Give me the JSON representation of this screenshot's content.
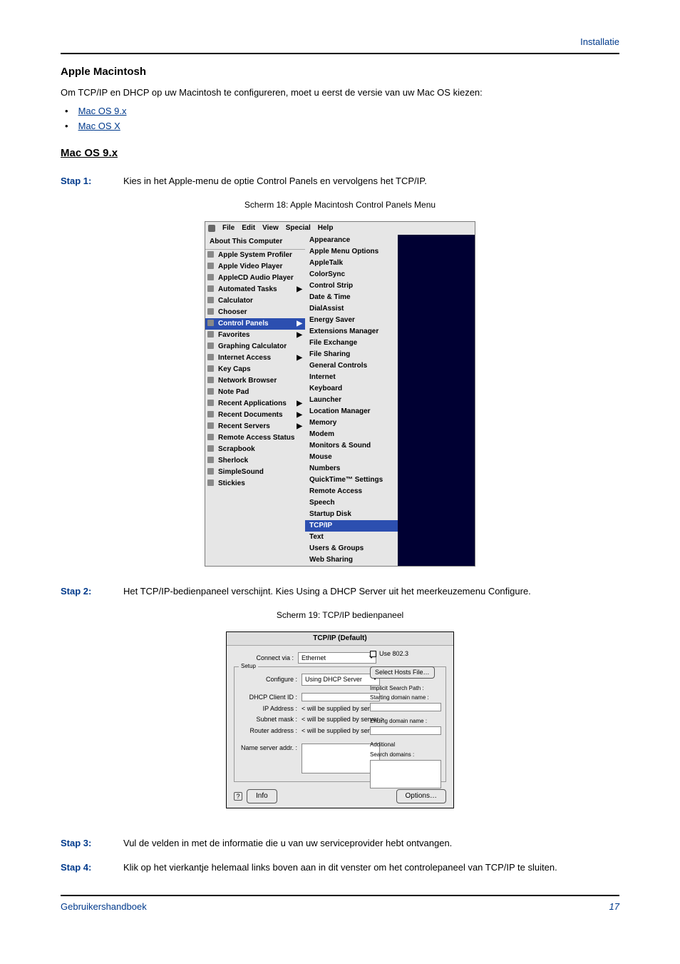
{
  "header": {
    "section": "Installatie"
  },
  "titles": {
    "apple_mac": "Apple Macintosh",
    "mac9": "Mac OS 9.x"
  },
  "intro": "Om TCP/IP en DHCP op uw Macintosh te configureren, moet u eerst de versie van uw Mac OS kiezen:",
  "links": {
    "mac9": "Mac OS 9.x",
    "macx": "Mac OS X"
  },
  "steps": {
    "s1_label": "Stap 1:",
    "s1_text": "Kies in het Apple-menu de optie Control Panels en vervolgens het TCP/IP.",
    "s2_label": "Stap 2:",
    "s2_text": "Het TCP/IP-bedienpaneel verschijnt. Kies Using a DHCP Server uit het meerkeuzemenu Configure.",
    "s3_label": "Stap 3:",
    "s3_text": "Vul de velden in met de informatie die u van uw serviceprovider hebt ontvangen.",
    "s4_label": "Stap 4:",
    "s4_text": "Klik op het vierkantje helemaal links boven aan in dit venster om het controlepaneel van TCP/IP te sluiten."
  },
  "captions": {
    "c18": "Scherm 18: Apple Macintosh Control Panels Menu",
    "c19": "Scherm 19: TCP/IP bedienpaneel"
  },
  "apple_menu": {
    "menubar": [
      "File",
      "Edit",
      "View",
      "Special",
      "Help"
    ],
    "top": "About This Computer",
    "items": [
      "Apple System Profiler",
      "Apple Video Player",
      "AppleCD Audio Player",
      "Automated Tasks",
      "Calculator",
      "Chooser",
      "Control Panels",
      "Favorites",
      "Graphing Calculator",
      "Internet Access",
      "Key Caps",
      "Network Browser",
      "Note Pad",
      "Recent Applications",
      "Recent Documents",
      "Recent Servers",
      "Remote Access Status",
      "Scrapbook",
      "Sherlock",
      "SimpleSound",
      "Stickies"
    ],
    "sub": [
      "Appearance",
      "Apple Menu Options",
      "AppleTalk",
      "ColorSync",
      "Control Strip",
      "Date & Time",
      "DialAssist",
      "Energy Saver",
      "Extensions Manager",
      "File Exchange",
      "File Sharing",
      "General Controls",
      "Internet",
      "Keyboard",
      "Launcher",
      "Location Manager",
      "Memory",
      "Modem",
      "Monitors & Sound",
      "Mouse",
      "Numbers",
      "QuickTime™ Settings",
      "Remote Access",
      "Speech",
      "Startup Disk",
      "TCP/IP",
      "Text",
      "Users & Groups",
      "Web Sharing"
    ]
  },
  "tcpip": {
    "title": "TCP/IP (Default)",
    "connect_via_lbl": "Connect via :",
    "connect_via_val": "Ethernet",
    "use8023": "Use 802.3",
    "setup": "Setup",
    "configure_lbl": "Configure :",
    "configure_val": "Using DHCP Server",
    "select_hosts": "Select Hosts File…",
    "implicit": "Implicit Search Path :",
    "starting": "Starting domain name :",
    "ending": "Ending domain name :",
    "additional": "Additional",
    "search_domains": "Search domains :",
    "dhcp_client_lbl": "DHCP Client ID :",
    "ip_lbl": "IP Address :",
    "subnet_lbl": "Subnet mask :",
    "router_lbl": "Router address :",
    "namesrv_lbl": "Name server addr. :",
    "supplied": "< will be supplied by server >",
    "info": "Info",
    "options": "Options…"
  },
  "footer": {
    "left": "Gebruikershandboek",
    "page": "17"
  }
}
